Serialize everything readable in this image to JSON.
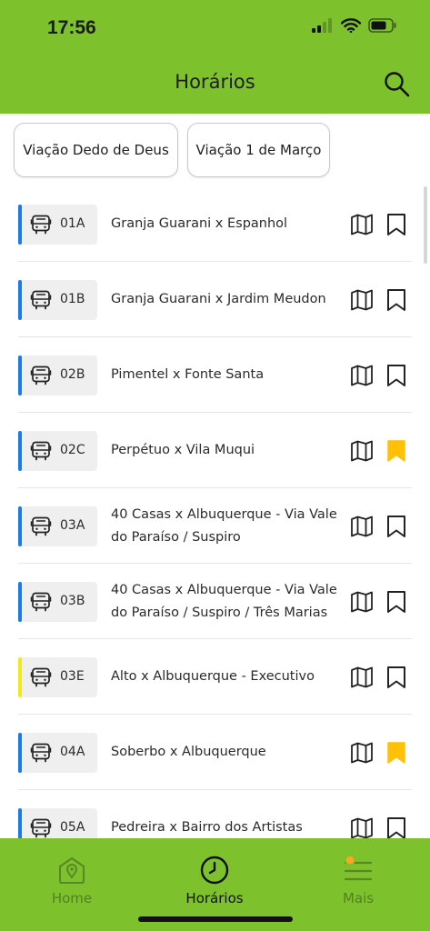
{
  "status": {
    "time": "17:56"
  },
  "header": {
    "title": "Horários",
    "search_icon": "search-icon",
    "background": "#7dc12d"
  },
  "companies": [
    {
      "label": "Viação Dedo de Deus"
    },
    {
      "label": "Viação 1 de Março"
    }
  ],
  "lines": [
    {
      "code": "01A",
      "route": "Granja Guarani x Espanhol",
      "color": "#1a7be8",
      "favorite": false
    },
    {
      "code": "01B",
      "route": "Granja Guarani x Jardim Meudon",
      "color": "#1a7be8",
      "favorite": false
    },
    {
      "code": "02B",
      "route": "Pimentel x Fonte Santa",
      "color": "#1a7be8",
      "favorite": false
    },
    {
      "code": "02C",
      "route": "Perpétuo x Vila Muqui",
      "color": "#1a7be8",
      "favorite": true
    },
    {
      "code": "03A",
      "route": "40 Casas x Albuquerque - Via Vale do Paraíso / Suspiro",
      "color": "#1a7be8",
      "favorite": false
    },
    {
      "code": "03B",
      "route": "40 Casas x Albuquerque - Via Vale do Paraíso / Suspiro / Três Marias",
      "color": "#1a7be8",
      "favorite": false
    },
    {
      "code": "03E",
      "route": "Alto x Albuquerque - Executivo",
      "color": "#f2ea16",
      "favorite": false
    },
    {
      "code": "04A",
      "route": "Soberbo x Albuquerque",
      "color": "#1a7be8",
      "favorite": true
    },
    {
      "code": "05A",
      "route": "Pedreira x Bairro dos Artistas",
      "color": "#1a7be8",
      "favorite": false
    }
  ],
  "colors": {
    "favorite": "#ffc107",
    "accent": "#7dc12d"
  },
  "tabs": [
    {
      "label": "Home",
      "icon": "home-pin-icon",
      "active": false
    },
    {
      "label": "Horários",
      "icon": "clock-icon",
      "active": true
    },
    {
      "label": "Mais",
      "icon": "menu-icon",
      "active": false
    }
  ]
}
